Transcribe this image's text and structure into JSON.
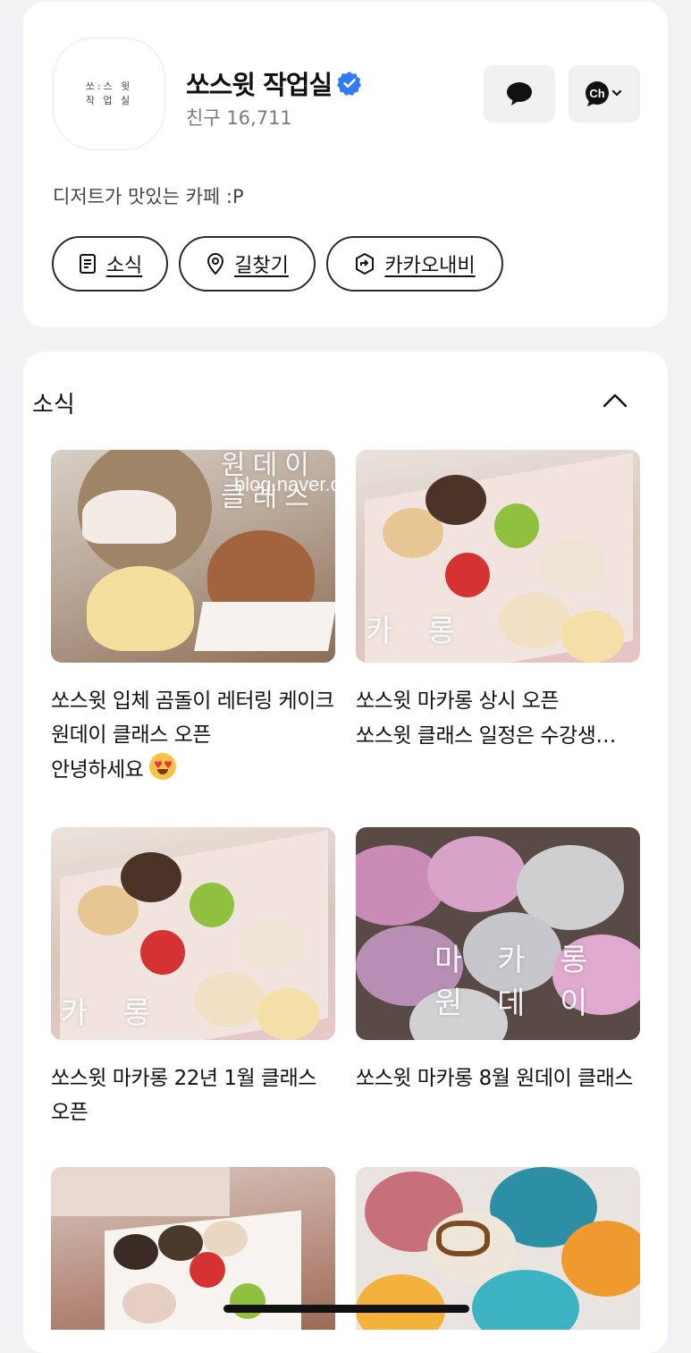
{
  "profile": {
    "avatar_line1": "쏘:스 윗",
    "avatar_line2": "작 업 실",
    "name": "쏘스윗 작업실",
    "friends": "친구 16,711",
    "description": "디저트가 맛있는 카페 :P",
    "buttons": [
      "소식",
      "길찾기",
      "카카오내비"
    ]
  },
  "news": {
    "section_title": "소식",
    "posts": [
      {
        "title": "쏘스윗 입체 곰돌이 레터링 케이크 원데이 클래스 오픈",
        "subtitle": "안녕하세요",
        "overlay": "원데이 클래스",
        "watermark": "blog.naver.com/sulji_"
      },
      {
        "title": "쏘스윗 마카롱 상시 오픈",
        "subtitle": "쏘스윗 클래스 일정은 수강생…",
        "overlay": "카 롱"
      },
      {
        "title": "쏘스윗 마카롱 22년 1월 클래스 오픈",
        "subtitle": "",
        "overlay": "카 롱"
      },
      {
        "title": "쏘스윗 마카롱 8월 원데이 클래스",
        "subtitle": "",
        "overlay": "마 카 롱\n원 데 이"
      },
      {
        "title": "",
        "subtitle": "",
        "overlay": ""
      },
      {
        "title": "",
        "subtitle": "",
        "overlay": ""
      }
    ]
  },
  "colors": {
    "verified": "#2f7cf6",
    "background": "#f2f2f4"
  },
  "icons": [
    "verified-badge-icon",
    "chat-icon",
    "channel-icon",
    "news-icon",
    "location-pin-icon",
    "kakaonavi-icon",
    "chevron-up-icon"
  ]
}
